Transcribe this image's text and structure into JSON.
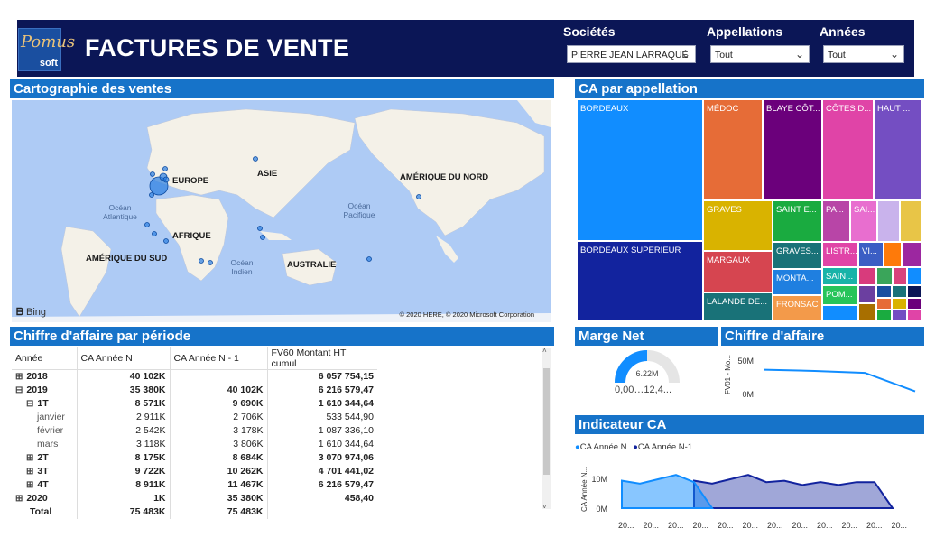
{
  "header": {
    "title": "FACTURES DE VENTE",
    "logo_script": "Pomus",
    "logo_text": "soft"
  },
  "slicers": [
    {
      "label": "Sociétés",
      "value": "PIERRE JEAN LARRAQUÉ"
    },
    {
      "label": "Appellations",
      "value": "Tout"
    },
    {
      "label": "Années",
      "value": "Tout"
    }
  ],
  "map_panel": {
    "title": "Cartographie des ventes",
    "continents": [
      "EUROPE",
      "ASIE",
      "AMÉRIQUE DU NORD",
      "AFRIQUE",
      "AMÉRIQUE DU SUD",
      "AUSTRALIE"
    ],
    "oceans": [
      "Océan Atlantique",
      "Océan Pacifique",
      "Océan Indien"
    ],
    "bing": "Bing",
    "copyright": "© 2020 HERE, © 2020 Microsoft Corporation"
  },
  "treemap_panel": {
    "title": "CA par appellation",
    "tiles": [
      "BORDEAUX",
      "BORDEAUX SUPÉRIEUR",
      "MÉDOC",
      "BLAYE CÔT...",
      "CÔTES D...",
      "HAUT ...",
      "GRAVES",
      "SAINT E...",
      "PA...",
      "SAI...",
      "MARGAUX",
      "GRAVES...",
      "LISTR...",
      "VI...",
      "MONTA...",
      "SAIN...",
      "POM...",
      "LALANDE DE...",
      "FRONSAC"
    ]
  },
  "table_panel": {
    "title": "Chiffre d'affaire par période",
    "columns": [
      "Année",
      "CA Année N",
      "CA Année N - 1",
      "FV60 Montant HT cumul"
    ],
    "rows": [
      {
        "label": "2018",
        "level": 0,
        "expander": "⊞",
        "bold": true,
        "n": "40 102K",
        "n1": "",
        "cumul": "6 057 754,15"
      },
      {
        "label": "2019",
        "level": 0,
        "expander": "⊟",
        "bold": true,
        "n": "35 380K",
        "n1": "40 102K",
        "cumul": "6 216 579,47"
      },
      {
        "label": "1T",
        "level": 1,
        "expander": "⊟",
        "bold": true,
        "n": "8 571K",
        "n1": "9 690K",
        "cumul": "1 610 344,64"
      },
      {
        "label": "janvier",
        "level": 2,
        "expander": "",
        "bold": false,
        "n": "2 911K",
        "n1": "2 706K",
        "cumul": "533 544,90"
      },
      {
        "label": "février",
        "level": 2,
        "expander": "",
        "bold": false,
        "n": "2 542K",
        "n1": "3 178K",
        "cumul": "1 087 336,10"
      },
      {
        "label": "mars",
        "level": 2,
        "expander": "",
        "bold": false,
        "n": "3 118K",
        "n1": "3 806K",
        "cumul": "1 610 344,64"
      },
      {
        "label": "2T",
        "level": 1,
        "expander": "⊞",
        "bold": true,
        "n": "8 175K",
        "n1": "8 684K",
        "cumul": "3 070 974,06"
      },
      {
        "label": "3T",
        "level": 1,
        "expander": "⊞",
        "bold": true,
        "n": "9 722K",
        "n1": "10 262K",
        "cumul": "4 701 441,02"
      },
      {
        "label": "4T",
        "level": 1,
        "expander": "⊞",
        "bold": true,
        "n": "8 911K",
        "n1": "11 467K",
        "cumul": "6 216 579,47"
      },
      {
        "label": "2020",
        "level": 0,
        "expander": "⊞",
        "bold": true,
        "n": "1K",
        "n1": "35 380K",
        "cumul": "458,40"
      }
    ],
    "total": {
      "label": "Total",
      "n": "75 483K",
      "n1": "75 483K",
      "cumul": ""
    }
  },
  "marge_panel": {
    "title": "Marge Net",
    "value": "6.22M",
    "min_label": "0,00",
    "max_label": "12,4...",
    "fraction": 0.5
  },
  "ca_panel": {
    "title": "Chiffre d'affaire",
    "ylabel": "FV01 - Mo...",
    "ticks": [
      "50M",
      "0M"
    ]
  },
  "indicateur_panel": {
    "title": "Indicateur CA",
    "legend": [
      "CA Année N",
      "CA Année N-1"
    ],
    "ylabel": "CA Année N...",
    "yticks": [
      "10M",
      "0M"
    ],
    "xtick": "20..."
  },
  "chart_data": [
    {
      "type": "line",
      "title": "Chiffre d'affaire",
      "ylabel": "FV01 - Mo...",
      "ylim": [
        0,
        60
      ],
      "y_ticks": [
        "50M",
        "0M"
      ],
      "series": [
        {
          "values": [
            40,
            38,
            35,
            5
          ]
        }
      ]
    },
    {
      "type": "area",
      "title": "Indicateur CA",
      "ylabel": "CA Année N...",
      "ylim": [
        0,
        14
      ],
      "x_tick_label": "20...",
      "series": [
        {
          "name": "CA Année N",
          "color": "#118dff",
          "values": [
            9.5,
            8.5,
            10,
            11.5,
            9,
            0,
            0,
            0,
            0,
            0,
            0,
            0,
            0,
            0,
            0,
            0,
            0
          ]
        },
        {
          "name": "CA Année N-1",
          "color": "#12239e",
          "values": [
            0,
            0,
            0,
            0,
            9.5,
            8.5,
            10,
            11.5,
            9,
            9.5,
            8,
            9,
            8,
            9,
            9,
            0,
            0
          ]
        }
      ]
    }
  ]
}
